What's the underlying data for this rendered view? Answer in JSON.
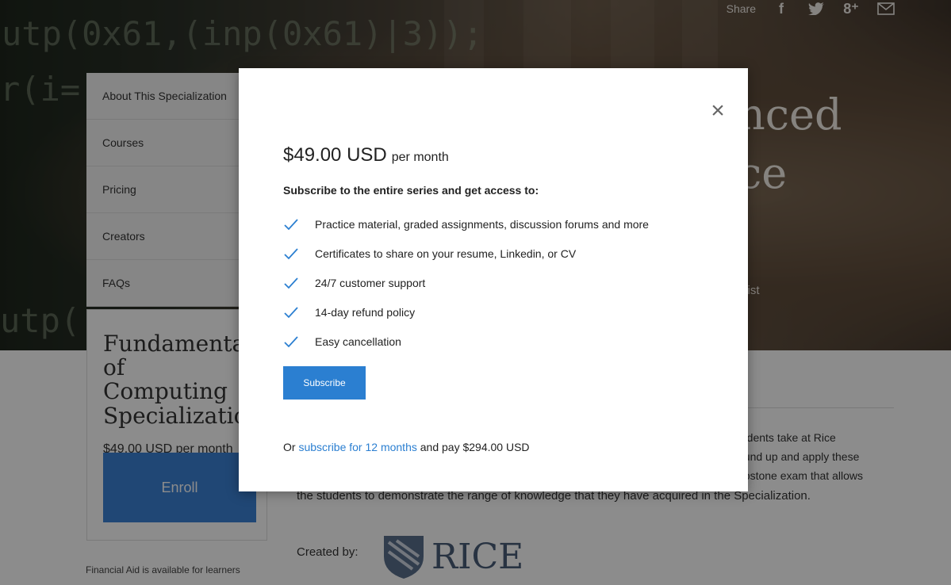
{
  "share": {
    "label": "Share",
    "icons": [
      "facebook-icon",
      "twitter-icon",
      "google-plus-icon",
      "mail-icon"
    ]
  },
  "hero": {
    "code_lines": [
      "utp(0x61,(inp(0x61)|3));",
      "r(i=",
      "utp("
    ],
    "title_line1": "nced",
    "title_line2": "ce",
    "subtitle": "ntist"
  },
  "sidenav": {
    "items": [
      {
        "label": "About This Specialization"
      },
      {
        "label": "Courses"
      },
      {
        "label": "Pricing"
      },
      {
        "label": "Creators"
      },
      {
        "label": "FAQs"
      }
    ]
  },
  "enroll_card": {
    "title": "Fundamentals of Computing Specialization",
    "price": "$49.00 USD per month",
    "enroll_label": "Enroll"
  },
  "financial_aid": "Financial Aid is available for learners",
  "description": {
    "line1": "tudents take at Rice",
    "line2": "ound up and apply these",
    "line3": "apstone exam that allows",
    "bottom": "the students to demonstrate the range of knowledge that they have acquired in the Specialization."
  },
  "created_by": {
    "label": "Created by:",
    "institution": "RICE"
  },
  "modal": {
    "price_amount": "$49.00 USD",
    "price_period": "per month",
    "subtitle": "Subscribe to the entire series and get access to:",
    "benefits": [
      "Practice material, graded assignments, discussion forums and more",
      "Certificates to share on your resume, Linkedin, or CV",
      "24/7 customer support",
      "14-day refund policy",
      "Easy cancellation"
    ],
    "subscribe_label": "Subscribe",
    "annual_prefix": "Or ",
    "annual_link": "subscribe for 12 months",
    "annual_suffix": " and pay $294.00 USD",
    "close_icon": "close-icon"
  },
  "colors": {
    "accent": "#2b7fd1",
    "enroll": "#3b82d6",
    "overlay": "rgba(0,0,0,0.45)"
  }
}
